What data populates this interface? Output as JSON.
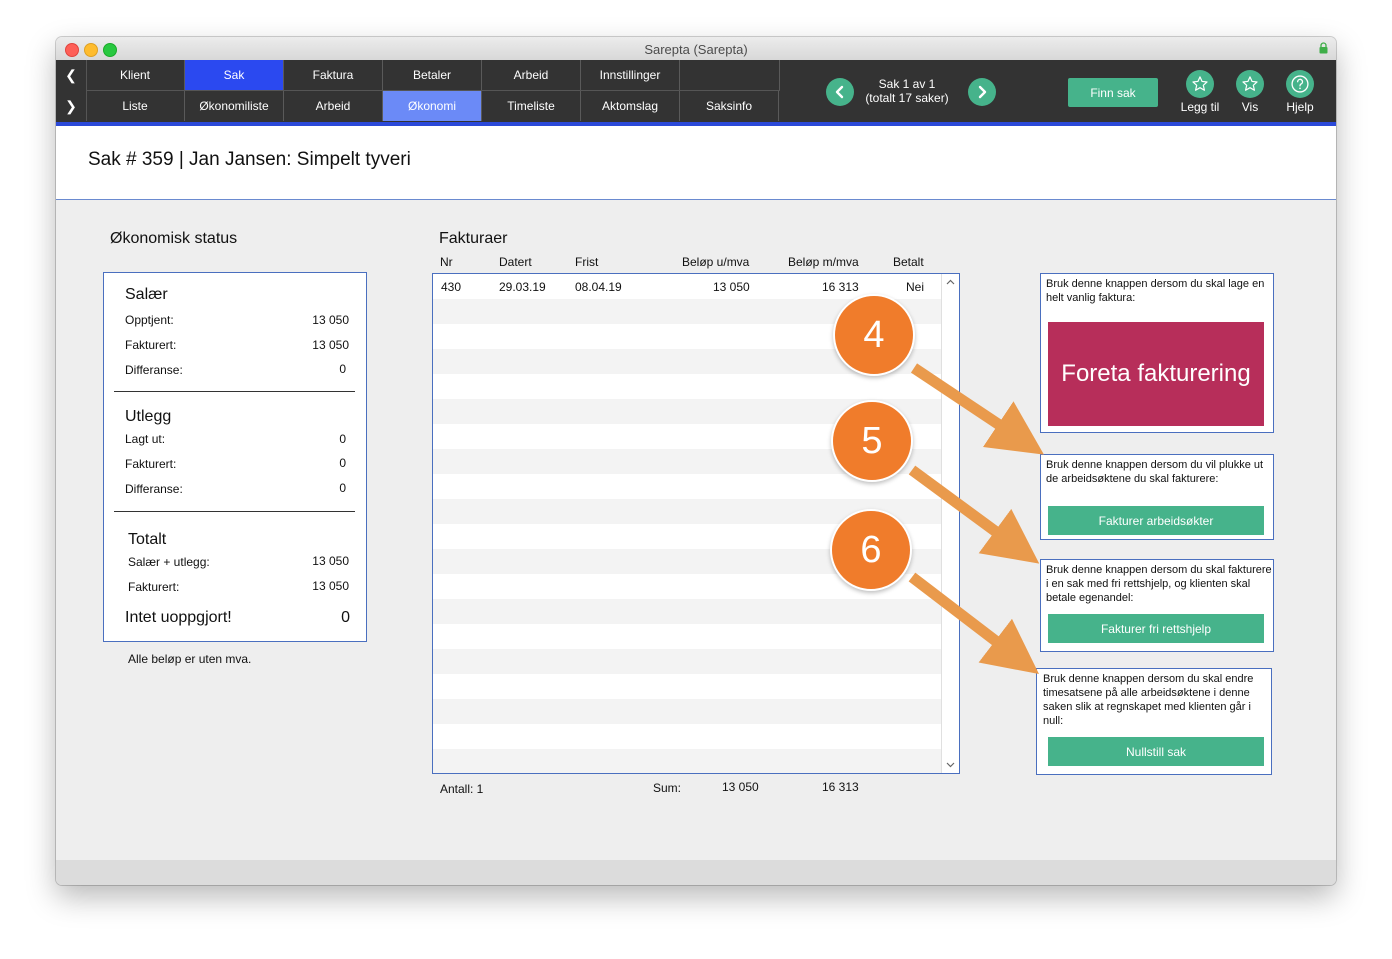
{
  "window": {
    "title": "Sarepta (Sarepta)"
  },
  "nav": {
    "main": [
      "Klient",
      "Sak",
      "Faktura",
      "Betaler",
      "Arbeid",
      "Innstillinger"
    ],
    "sub": [
      "Liste",
      "Økonomiliste",
      "Arbeid",
      "Økonomi",
      "Timeliste",
      "Aktomslag",
      "Saksinfo"
    ],
    "active_main": "Sak",
    "active_sub": "Økonomi"
  },
  "case_nav": {
    "line1": "Sak 1 av 1",
    "line2": "(totalt 17 saker)"
  },
  "toolbar": {
    "finn_sak": "Finn sak",
    "legg_til": "Legg til",
    "vis": "Vis",
    "hjelp": "Hjelp"
  },
  "page_title": "Sak # 359 | Jan Jansen: Simpelt tyveri",
  "status": {
    "heading": "Økonomisk status",
    "salaer": {
      "title": "Salær",
      "opptjent_label": "Opptjent:",
      "opptjent": "13 050",
      "fakturert_label": "Fakturert:",
      "fakturert": "13 050",
      "differanse_label": "Differanse:",
      "differanse": "0"
    },
    "utlegg": {
      "title": "Utlegg",
      "lagt_ut_label": "Lagt ut:",
      "lagt_ut": "0",
      "fakturert_label": "Fakturert:",
      "fakturert": "0",
      "differanse_label": "Differanse:",
      "differanse": "0"
    },
    "totalt": {
      "title": "Totalt",
      "salaer_utlegg_label": "Salær + utlegg:",
      "salaer_utlegg": "13 050",
      "fakturert_label": "Fakturert:",
      "fakturert": "13 050"
    },
    "uoppgjort_label": "Intet uoppgjort!",
    "uoppgjort": "0",
    "note": "Alle beløp er uten mva."
  },
  "invoices": {
    "heading": "Fakturaer",
    "columns": {
      "nr": "Nr",
      "datert": "Datert",
      "frist": "Frist",
      "belop_u": "Beløp u/mva",
      "belop_m": "Beløp m/mva",
      "betalt": "Betalt"
    },
    "rows": [
      {
        "nr": "430",
        "datert": "29.03.19",
        "frist": "08.04.19",
        "belop_u": "13 050",
        "belop_m": "16 313",
        "betalt": "Nei"
      }
    ],
    "antall": "Antall: 1",
    "sum_label": "Sum:",
    "sum_u": "13 050",
    "sum_m": "16 313"
  },
  "actions": {
    "a1": {
      "text": "Bruk denne knappen dersom du skal lage en helt vanlig faktura:",
      "button": "Foreta fakturering"
    },
    "a2": {
      "text": "Bruk denne knappen dersom du vil plukke ut de arbeidsøktene du skal fakturere:",
      "button": "Fakturer arbeidsøkter"
    },
    "a3": {
      "text": "Bruk denne knappen dersom du skal fakturere i en sak med fri rettshjelp, og klienten skal betale egenandel:",
      "button": "Fakturer fri rettshjelp"
    },
    "a4": {
      "text": "Bruk denne knappen dersom du skal endre timesatsene på alle arbeidsøktene i denne saken slik at regnskapet med klienten går i null:",
      "button": "Nullstill sak"
    }
  },
  "callouts": {
    "c4": "4",
    "c5": "5",
    "c6": "6"
  },
  "colors": {
    "accent_blue": "#2b49f0",
    "sub_active": "#6b8af7",
    "green": "#46b38b",
    "magenta": "#b72e5a",
    "callout": "#f07c2b"
  }
}
